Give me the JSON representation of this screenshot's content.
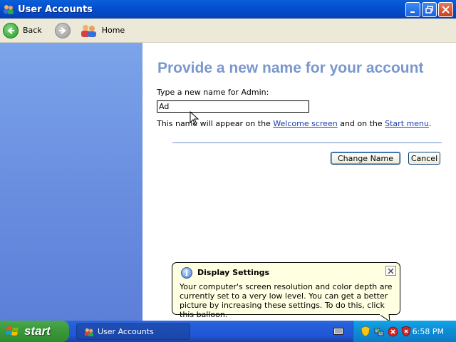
{
  "window": {
    "title": "User Accounts"
  },
  "nav": {
    "back_label": "Back",
    "home_label": "Home"
  },
  "main": {
    "heading": "Provide a new name for your account",
    "prompt": "Type a new name for Admin:",
    "name_value": "Ad",
    "info_prefix": "This name will appear on the ",
    "info_link1": "Welcome screen",
    "info_mid": " and on the ",
    "info_link2": "Start menu",
    "info_suffix": ".",
    "change_button": "Change Name",
    "cancel_button": "Cancel"
  },
  "balloon": {
    "title": "Display Settings",
    "text": "Your computer's screen resolution and color depth are currently set to a very low level. You can get a better picture by increasing these settings. To do this, click this balloon.",
    "icon": "info-icon"
  },
  "taskbar": {
    "start_label": "start",
    "task_label": "User Accounts",
    "clock": "6:58 PM"
  },
  "colors": {
    "title_bar": "#0550d1",
    "heading": "#7a97cd",
    "left_pane": "#6a8fe0",
    "start": "#3c9a3c",
    "tray": "#0f8fd8",
    "balloon": "#ffffe1"
  }
}
